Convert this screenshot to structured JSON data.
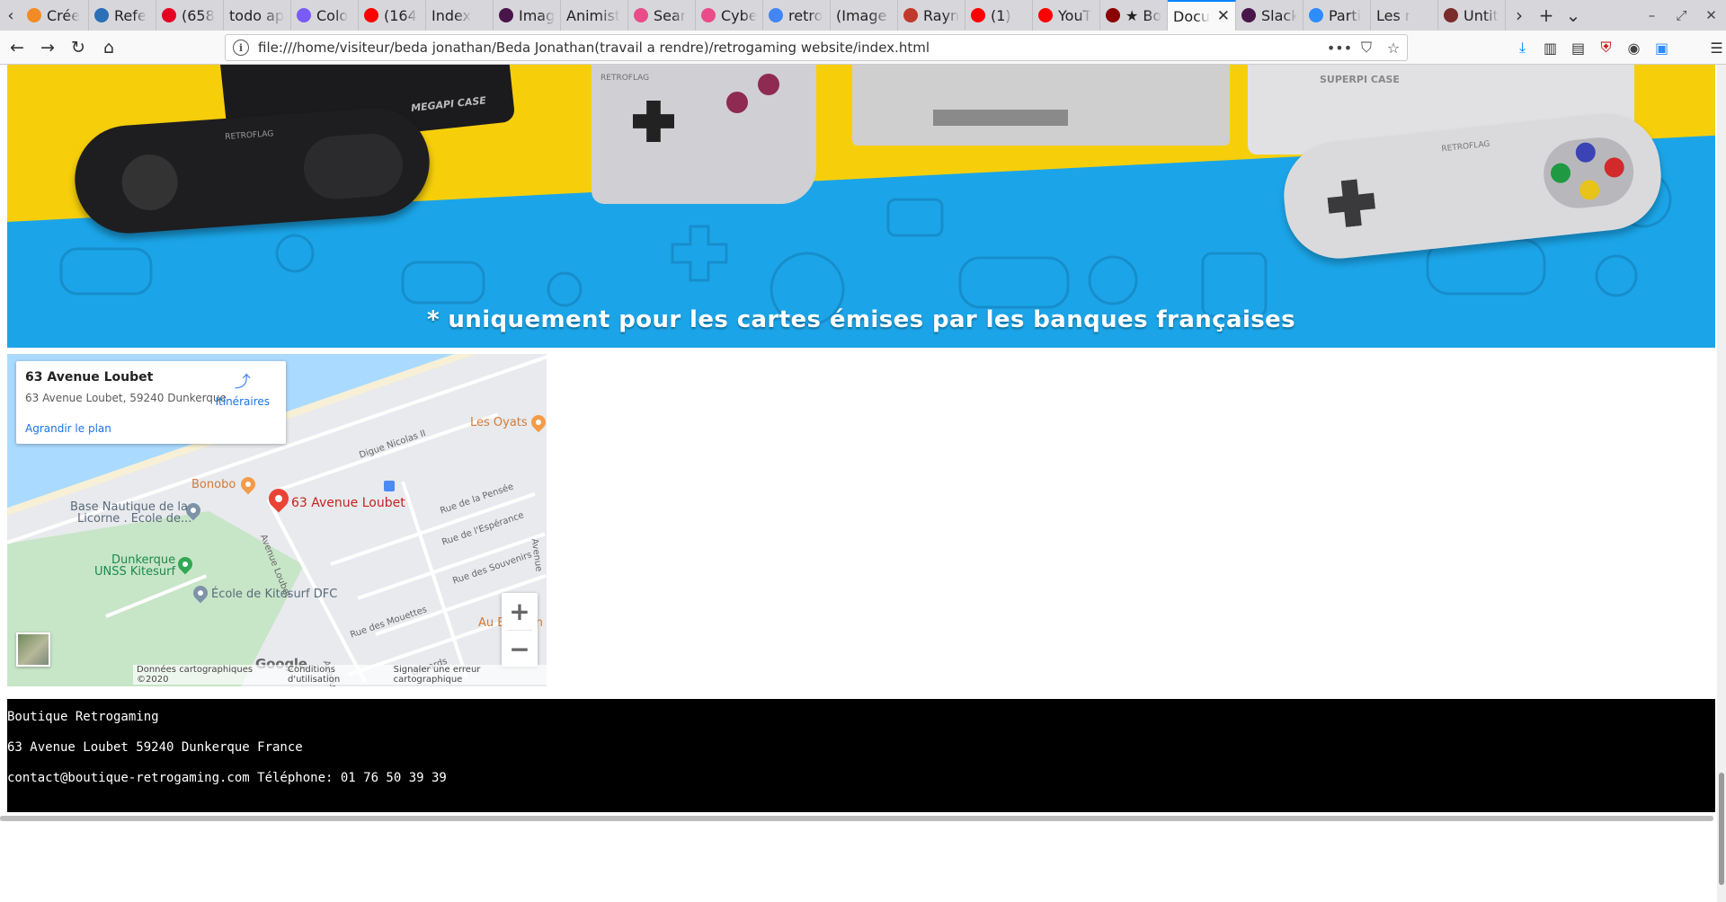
{
  "tabs": [
    {
      "label": "Crée",
      "icon": "codepen-icon",
      "color": "#f38b24"
    },
    {
      "label": "Refe",
      "icon": "site-icon",
      "color": "#2a6fb7"
    },
    {
      "label": "(658",
      "icon": "pinterest-icon",
      "color": "#e60023"
    },
    {
      "label": "todo app",
      "icon": "",
      "color": ""
    },
    {
      "label": "Colo",
      "icon": "coolors-icon",
      "color": "#7a5af8"
    },
    {
      "label": "(164",
      "icon": "youtube-icon",
      "color": "#ff0000"
    },
    {
      "label": "Index",
      "icon": "",
      "color": ""
    },
    {
      "label": "Imag",
      "icon": "slack-hash-icon",
      "color": "#4a154b"
    },
    {
      "label": "Animist",
      "icon": "",
      "color": ""
    },
    {
      "label": "Sear",
      "icon": "dribbble-icon",
      "color": "#ea4c89"
    },
    {
      "label": "Cybe",
      "icon": "dribbble-icon",
      "color": "#ea4c89"
    },
    {
      "label": "retro",
      "icon": "google-icon",
      "color": "#4285f4"
    },
    {
      "label": "(Image P",
      "icon": "",
      "color": ""
    },
    {
      "label": "Rayn",
      "icon": "site-icon",
      "color": "#c0392b"
    },
    {
      "label": "(1)",
      "icon": "youtube-icon",
      "color": "#ff0000"
    },
    {
      "label": "YouT",
      "icon": "youtube-icon",
      "color": "#ff0000"
    },
    {
      "label": "★ Bo",
      "icon": "site-icon",
      "color": "#8b0000"
    },
    {
      "label": "Docu",
      "icon": "",
      "color": "",
      "active": true
    },
    {
      "label": "Slack",
      "icon": "slack-icon",
      "color": "#4a154b"
    },
    {
      "label": "Parti",
      "icon": "zoom-icon",
      "color": "#2d8cff"
    },
    {
      "label": "Les r",
      "icon": "",
      "color": ""
    },
    {
      "label": "Untit",
      "icon": "figma-icon",
      "color": "#7a2b2b"
    }
  ],
  "browser": {
    "url": "file:///home/visiteur/beda jonathan/Beda Jonathan(travail a rendre)/retrogaming website/index.html"
  },
  "banner": {
    "caption": "* uniquement pour les cartes émises par les banques françaises",
    "console_text_1": "MEGAPI CASE",
    "console_text_2": "SUPERPI CASE",
    "brand_1": "RETROFLAG",
    "brand_2": "RETROFLAG",
    "brand_3": "RETROFLAG"
  },
  "map": {
    "card_title": "63 Avenue Loubet",
    "card_address": "63 Avenue Loubet, 59240 Dunkerque",
    "directions_label": "Itinéraires",
    "enlarge_label": "Agrandir le plan",
    "marker_label": "63 Avenue Loubet",
    "places": {
      "les_oyats": "Les Oyats",
      "bonobo": "Bonobo",
      "base_nautique_1": "Base Nautique de la",
      "base_nautique_2": "Licorne . Ecole de...",
      "dunkerque_1": "Dunkerque",
      "dunkerque_2": "UNSS Kitesurf",
      "ecole": "École de Kitesurf DFC",
      "au": "Au B",
      "au_end": "in"
    },
    "streets": {
      "digue": "Digue Nicolas II",
      "pensee": "Rue de la Pensée",
      "esperance": "Rue de l'Espérance",
      "souvenirs": "Rue des Souvenirs",
      "mouettes": "Rue des Mouettes",
      "loubet": "Avenue Loubet",
      "loubet2": "Avenue Loubet",
      "avenue_right": "Avenue",
      "grisards": "Grisards"
    },
    "zoom_in": "+",
    "zoom_out": "−",
    "google": "Google",
    "footer": {
      "data": "Données cartographiques ©2020",
      "terms": "Conditions d'utilisation",
      "report": "Signaler une erreur cartographique"
    }
  },
  "footer": {
    "line1": "Boutique Retrogaming",
    "line2": "63 Avenue Loubet 59240 Dunkerque France",
    "line3": "contact@boutique-retrogaming.com Téléphone: 01 76 50 39 39"
  }
}
